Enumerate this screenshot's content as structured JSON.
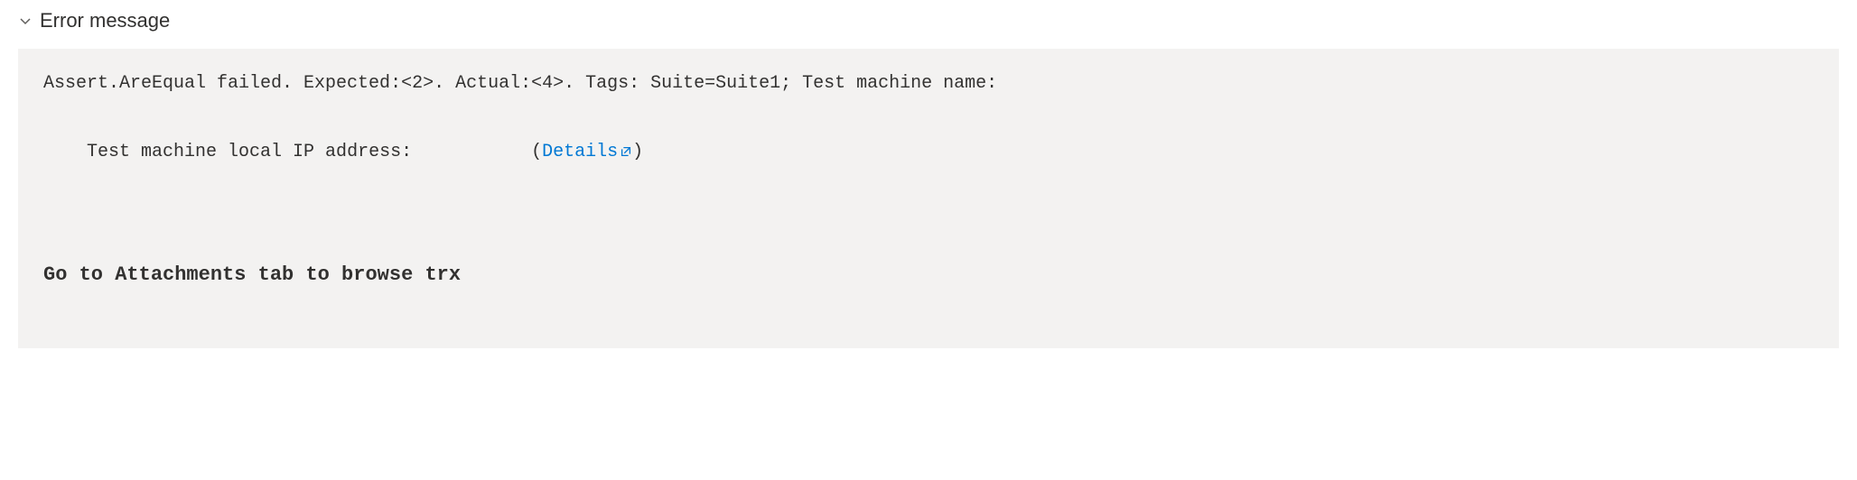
{
  "header": {
    "title": "Error message"
  },
  "error": {
    "line1": "Assert.AreEqual failed. Expected:<2>. Actual:<4>. Tags: Suite=Suite1; Test machine name:",
    "line2_prefix": "Test machine local IP address:           ",
    "details_open": "(",
    "details_label": "Details",
    "details_close": ")",
    "hint": "Go to Attachments tab to browse trx"
  }
}
